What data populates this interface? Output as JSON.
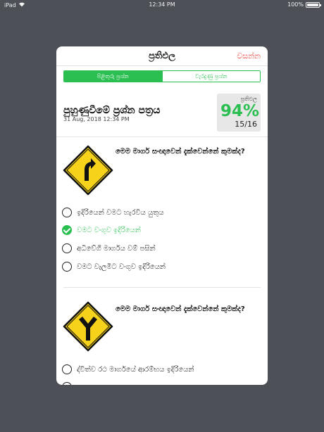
{
  "status_bar": {
    "device": "iPad",
    "time": "12:34 PM",
    "battery": "100%"
  },
  "modal": {
    "title": "ප්‍රතිඵල",
    "close_label": "වසන්න",
    "tabs": [
      {
        "label": "පිළිතුරු ප්‍රශ්න",
        "active": true
      },
      {
        "label": "වැරදුණු ප්‍රශ්න",
        "active": false
      }
    ],
    "paper": {
      "title": "පුහුණුවීමේ ප්‍රශ්න පත්‍රය",
      "date": "31 Aug, 2018 12:34 PM"
    },
    "score": {
      "label": "ප්‍රතිඵල",
      "percent": "94%",
      "count": "15/16"
    },
    "questions": [
      {
        "sign_icon": "curve-right-sign-icon",
        "text": "මෙම මාර්ග සංඥාවෙන් දැක්වෙන්නේ කුමක්ද?",
        "options": [
          {
            "label": "ඉදිරියෙන් වමට හැරවිය යුතුය",
            "checked": false
          },
          {
            "label": "වමට වංගුව ඉදිරියෙන්",
            "checked": true
          },
          {
            "label": "අධිවේගී මාර්ගය වම් පසින්",
            "checked": false
          },
          {
            "label": "වමට වැලමිට වංගුව ඉදිරියෙන්",
            "checked": false
          }
        ]
      },
      {
        "sign_icon": "y-junction-sign-icon",
        "text": "මෙම මාර්ග සංඥාවෙන් දැක්වෙන්නේ කුමක්ද?",
        "options": [
          {
            "label": "ද්විත්ව රථ මාර්ගයේ ආරම්භය ඉදිරියෙන්",
            "checked": false
          }
        ]
      }
    ]
  },
  "colors": {
    "accent": "#2bbf52",
    "close": "#e8413b",
    "backdrop": "#4d5157",
    "sign_yellow": "#f7d21a"
  }
}
